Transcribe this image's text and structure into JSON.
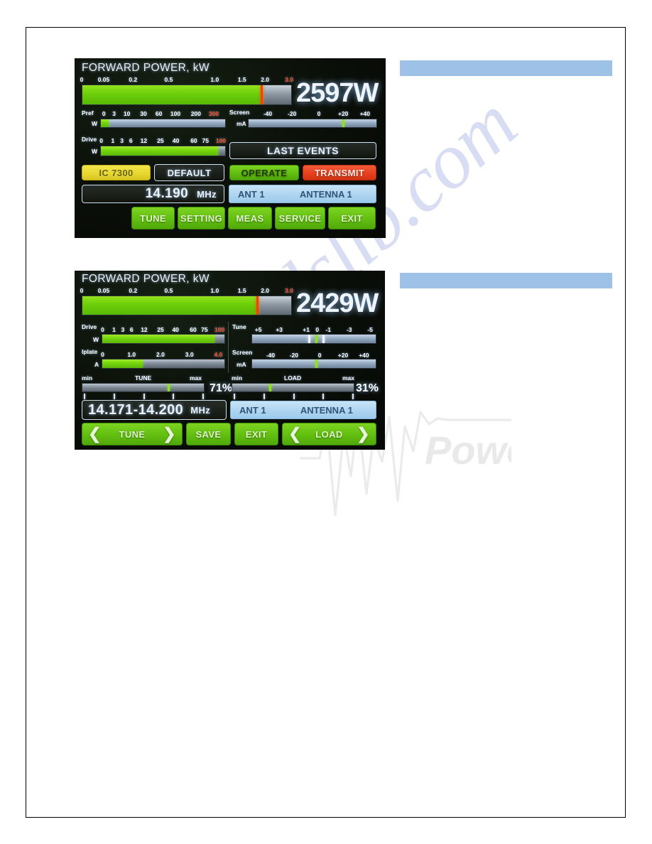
{
  "document": {
    "watermark_text": "manualslib.com",
    "logo_watermark": "SM Power",
    "redacted_bars": 2
  },
  "screens": [
    {
      "id": "screen-operate",
      "title": "FORWARD POWER, kW",
      "forward_power": {
        "label": "FORWARD POWER, kW",
        "ticks": [
          "0",
          "0.05",
          "0.2",
          "0.5",
          "1.0",
          "1.5",
          "2.0",
          "3.0"
        ],
        "tick_positions": [
          0,
          10.5,
          24.5,
          41.5,
          63.5,
          76.5,
          87.5,
          99
        ],
        "red_tick": "3.0",
        "fill_percent": 86,
        "value": "2597W",
        "unit": "W"
      },
      "pref": {
        "label": "Pref",
        "unit": "W",
        "ticks": [
          "0",
          "3",
          "10",
          "30",
          "60",
          "100",
          "200",
          "300"
        ],
        "tick_positions": [
          4,
          12,
          22,
          35,
          47,
          60,
          76,
          90
        ],
        "red_tick": "300",
        "fill_percent": 6
      },
      "screen_meter": {
        "label": "Screen",
        "unit": "mA",
        "ticks": [
          "-40",
          "-20",
          "0",
          "+20",
          "+40"
        ],
        "tick_positions": [
          15,
          34,
          55,
          74,
          91
        ],
        "marker_percent": 74
      },
      "drive": {
        "label": "Drive",
        "unit": "W",
        "ticks": [
          "0",
          "1",
          "3",
          "6",
          "12",
          "25",
          "40",
          "60",
          "75",
          "100"
        ],
        "tick_positions": [
          2,
          11,
          18,
          25,
          35,
          48,
          60,
          74,
          83,
          95
        ],
        "red_tick": "100",
        "fill_percent": 94
      },
      "buttons": {
        "last_events": "LAST EVENTS",
        "radio_model": "IC 7300",
        "preset": "DEFAULT",
        "mode": "OPERATE",
        "tx_state": "TRANSMIT",
        "frequency": "14.190",
        "frequency_unit": "MHz",
        "antenna_port": "ANT 1",
        "antenna_name": "ANTENNA 1",
        "menu": [
          "TUNE",
          "SETTING",
          "MEAS",
          "SERVICE",
          "EXIT"
        ]
      }
    },
    {
      "id": "screen-tune",
      "title": "FORWARD POWER, kW",
      "forward_power": {
        "label": "FORWARD POWER, kW",
        "ticks": [
          "0",
          "0.05",
          "0.2",
          "0.5",
          "1.0",
          "1.5",
          "2.0",
          "3.0"
        ],
        "tick_positions": [
          0,
          10.5,
          24.5,
          41.5,
          63.5,
          76.5,
          87.5,
          99
        ],
        "red_tick": "3.0",
        "fill_percent": 84,
        "value": "2429W",
        "unit": "W"
      },
      "drive": {
        "label": "Drive",
        "unit": "W",
        "ticks": [
          "0",
          "1",
          "3",
          "6",
          "12",
          "25",
          "40",
          "60",
          "75",
          "100"
        ],
        "tick_positions": [
          2,
          11,
          18,
          25,
          35,
          48,
          60,
          74,
          83,
          95
        ],
        "red_tick": "100",
        "fill_percent": 92
      },
      "iplate": {
        "label": "Iplate",
        "unit": "A",
        "ticks": [
          "0",
          "1.0",
          "2.0",
          "3.0",
          "4.0"
        ],
        "tick_positions": [
          2,
          25,
          48,
          71,
          94
        ],
        "red_tick": "4.0",
        "fill_percent": 33
      },
      "tune_meter": {
        "label": "Tune",
        "ticks": [
          "+5",
          "+3",
          "+1",
          "0",
          "-1",
          "-3",
          "-5"
        ],
        "tick_positions": [
          5,
          22,
          44,
          53,
          62,
          79,
          96
        ],
        "markers": [
          {
            "percent": 46,
            "color": "white"
          },
          {
            "percent": 52,
            "color": "green"
          },
          {
            "percent": 58,
            "color": "white"
          }
        ]
      },
      "screen_meter": {
        "label": "Screen",
        "unit": "mA",
        "ticks": [
          "-40",
          "-20",
          "0",
          "+20",
          "+40"
        ],
        "tick_positions": [
          15,
          34,
          55,
          74,
          91
        ],
        "marker_percent": 52
      },
      "tune_slider": {
        "label": "TUNE",
        "min_label": "min",
        "max_label": "max",
        "value_percent": 71,
        "value_text": "71%"
      },
      "load_slider": {
        "label": "LOAD",
        "min_label": "min",
        "max_label": "max",
        "value_percent": 31,
        "value_text": "31%"
      },
      "buttons": {
        "frequency": "14.171-14.200",
        "frequency_unit": "MHz",
        "antenna_port": "ANT 1",
        "antenna_name": "ANTENNA 1",
        "tune": "TUNE",
        "save": "SAVE",
        "exit": "EXIT",
        "load": "LOAD",
        "arrow_left": "❮",
        "arrow_right": "❯"
      }
    }
  ],
  "colors": {
    "green_button": "#62bf0f",
    "red_button": "#e8401c",
    "yellow_button": "#e6d62e",
    "light_blue_button": "#aed4f0",
    "bar_green": "#74d40c",
    "needle_red": "#ff3c00",
    "redaction_blue": "#9ec1e8",
    "watermark_lavender": "#b9c3ea"
  }
}
